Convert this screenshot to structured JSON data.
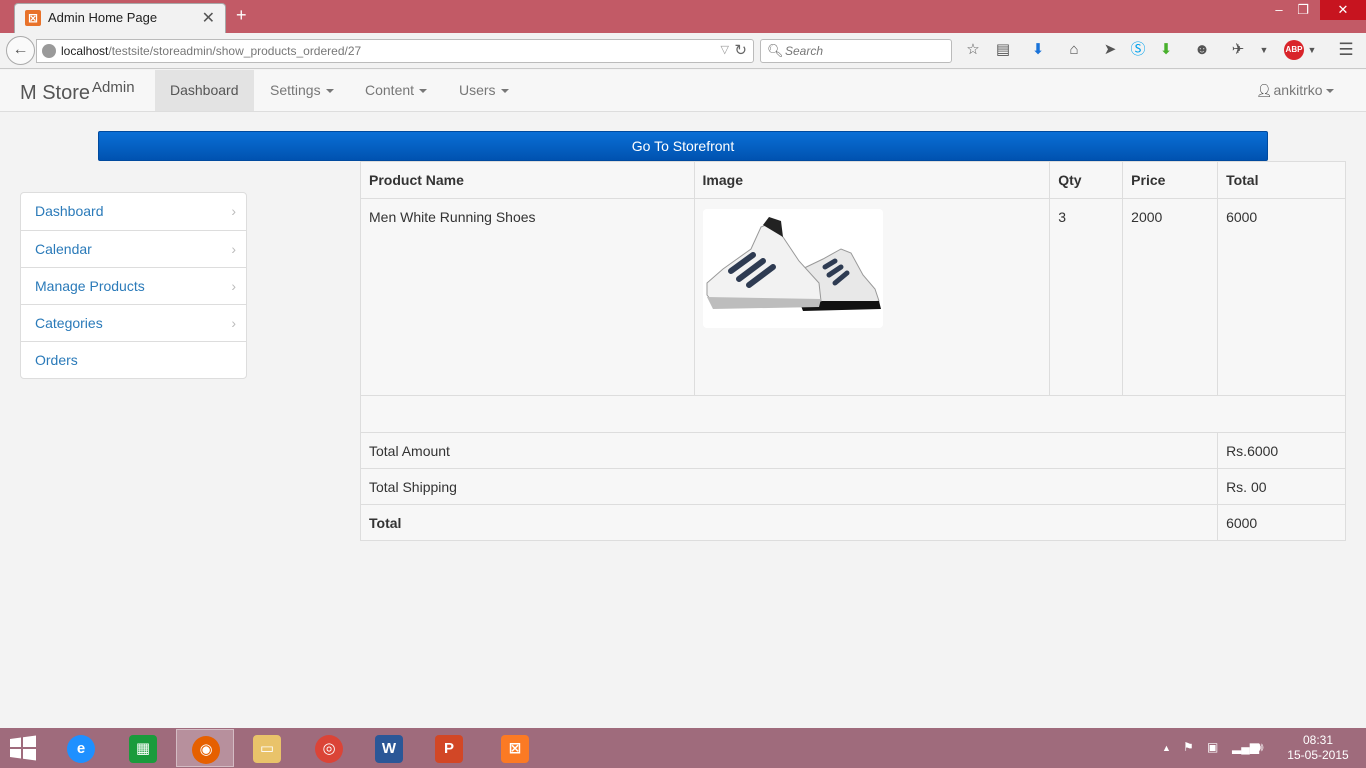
{
  "browser": {
    "tab_title": "Admin Home Page",
    "url_host": "localhost",
    "url_path": "/testsite/storeadmin/show_products_ordered/27",
    "search_placeholder": "Search"
  },
  "site": {
    "brand": "M Store",
    "brand_sup": "Admin",
    "nav": [
      {
        "label": "Dashboard"
      },
      {
        "label": "Settings"
      },
      {
        "label": "Content"
      },
      {
        "label": "Users"
      }
    ],
    "user": "ankitrko",
    "storefront_button": "Go To Storefront"
  },
  "sidebar": {
    "items": [
      {
        "label": "Dashboard"
      },
      {
        "label": "Calendar"
      },
      {
        "label": "Manage Products"
      },
      {
        "label": "Categories"
      },
      {
        "label": "Orders"
      }
    ]
  },
  "order": {
    "headers": [
      "Product Name",
      "Image",
      "Qty",
      "Price",
      "Total"
    ],
    "row": {
      "name": "Men White Running Shoes",
      "qty": "3",
      "price": "2000",
      "total": "6000"
    },
    "summary": [
      {
        "label": "Total Amount",
        "value": "Rs.6000"
      },
      {
        "label": "Total Shipping",
        "value": "Rs. 00"
      },
      {
        "label": "Total",
        "value": "6000"
      }
    ]
  },
  "taskbar": {
    "time": "08:31",
    "date": "15-05-2015"
  }
}
